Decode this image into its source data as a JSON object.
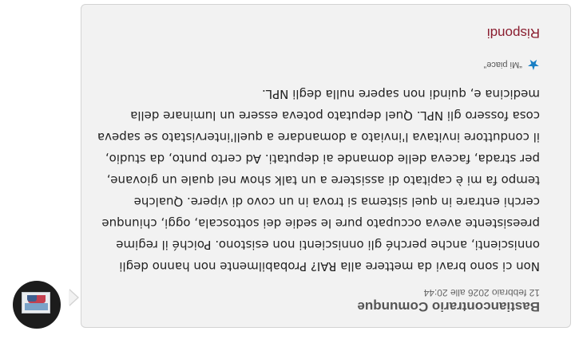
{
  "comment": {
    "author": "Bastiancontrario Comunque",
    "date": "12 febbraio 2026 alle 20:44",
    "paragraphs": [
      "Non ci sono bravi da mettere alla RAI? Probabilmente non hanno degli onniscienti, anche perché gli onniscienti non esistono. Poiché il regime preesistente aveva occupato pure le sedie dei sottoscala, oggi, chiunque cerchi entrare in quel sistema si trova in un covo di vipere. Qualche tempo fa mi è capitato di assistere a un talk show nel quale un giovane, per strada, faceva delle domande ai deputati. Ad certo punto, da studio, il conduttore invitava l'inviato a domandare a quell'intervistato se sapeva cosa fossero gli NPL. Quel deputato poteva essere un luminare della medicina e, quindi non sapere nulla degli NPL."
    ],
    "like_label": "“Mi piace”",
    "reply_label": "Rispondi"
  },
  "icons": {
    "like": "star-icon",
    "avatar": "user-avatar-photo"
  },
  "colors": {
    "reply": "#8a1d2f",
    "like_icon": "#1a7fc4",
    "card_bg": "#f2f2f2",
    "card_border": "#d3d3d3"
  }
}
